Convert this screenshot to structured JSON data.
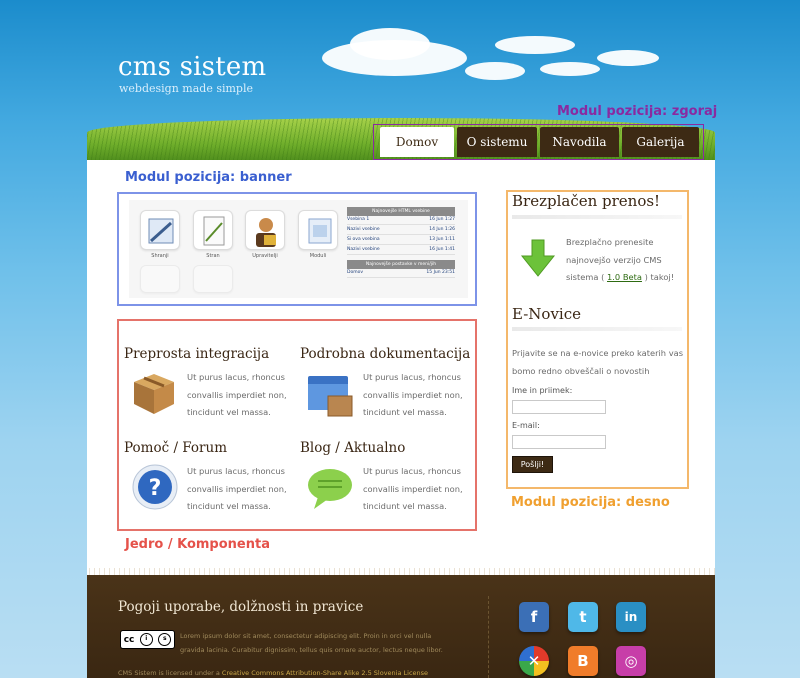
{
  "header": {
    "site_title": "cms sistem",
    "tagline": "webdesign made simple",
    "top_module_label": "Modul pozicija: zgoraj"
  },
  "nav": {
    "tabs": [
      {
        "label": "Domov",
        "active": true
      },
      {
        "label": "O sistemu",
        "active": false
      },
      {
        "label": "Navodila",
        "active": false
      },
      {
        "label": "Galerija",
        "active": false
      }
    ]
  },
  "banner": {
    "module_label": "Modul pozicija: banner",
    "icons": [
      {
        "label": "Shranji"
      },
      {
        "label": "Stran"
      },
      {
        "label": "Upravitelji"
      },
      {
        "label": "Moduli"
      }
    ],
    "table1_head": "Najnovejše HTML vsebine",
    "table1_rows": [
      {
        "name": "Vsebina 1",
        "date": "16 Jun 1:27"
      },
      {
        "name": "Nazivi vsebine",
        "date": "14 Jun 1:26"
      },
      {
        "name": "Si ova vsebina",
        "date": "13 Jun 1:11"
      },
      {
        "name": "Nazivi vsebine",
        "date": "16 Jun 1:41"
      }
    ],
    "table2_head": "Najnovejše postavke v meni/jih",
    "table2_rows": [
      {
        "name": "Domov",
        "date": "15 Jun 23:51"
      }
    ]
  },
  "component": {
    "module_label": "Jedro / Komponenta",
    "features": [
      {
        "title": "Preprosta integracija",
        "text": "Ut purus lacus, rhoncus convallis imperdiet non, tincidunt vel massa.",
        "icon": "box-icon"
      },
      {
        "title": "Podrobna dokumentacija",
        "text": "Ut purus lacus, rhoncus convallis imperdiet non, tincidunt vel massa.",
        "icon": "folder-icon"
      },
      {
        "title": "Pomoč / Forum",
        "text": "Ut purus lacus, rhoncus convallis imperdiet non, tincidunt vel massa.",
        "icon": "help-icon"
      },
      {
        "title": "Blog / Aktualno",
        "text": "Ut purus lacus, rhoncus convallis imperdiet non, tincidunt vel massa.",
        "icon": "speech-bubble-icon"
      }
    ]
  },
  "sidebar": {
    "module_label": "Modul pozicija: desno",
    "download_title": "Brezplačen prenos!",
    "download_text_1": "Brezplačno prenesite",
    "download_text_2": "najnovejšo verzijo CMS",
    "download_text_3_pre": "sistema (",
    "download_link": "1.0 Beta",
    "download_text_3_post": ") takoj!",
    "news_title": "E-Novice",
    "news_text_1": "Prijavite se na e-novice preko katerih vas",
    "news_text_2": "bomo redno obveščali o novostih",
    "name_label": "Ime in priimek:",
    "email_label": "E-mail:",
    "submit_label": "Pošlji!"
  },
  "footer": {
    "title": "Pogoji uporabe, dolžnosti in pravice",
    "cc_text": "cc",
    "lorem_1": "Lorem ipsum dolor sit amet, consectetur adipiscing elit. Proin in orci vel nulla",
    "lorem_2": "gravida lacinia. Curabitur dignissim, tellus quis ornare auctor, lectus neque libor.",
    "license_pre": "CMS Sistem is licensed under a",
    "license_link": "Creative Commons Attribution-Share Alike 2.5 Slovenia License",
    "social": [
      {
        "name": "facebook",
        "glyph": "f",
        "color": "#3b6fb6"
      },
      {
        "name": "twitter",
        "glyph": "t",
        "color": "#4fb8e8"
      },
      {
        "name": "linkedin",
        "glyph": "in",
        "color": "#2a8fc4"
      },
      {
        "name": "picasa",
        "glyph": "✕",
        "color": "#ffffff"
      },
      {
        "name": "blogger",
        "glyph": "B",
        "color": "#f07c2a"
      },
      {
        "name": "instagram",
        "glyph": "◎",
        "color": "#c73ea8"
      }
    ]
  },
  "colors": {
    "brown": "#3d2a14",
    "banner_border": "#7d93e8",
    "component_border": "#e5736a",
    "sidebar_border": "#f4b86b",
    "top_label": "#8a2aa0"
  }
}
